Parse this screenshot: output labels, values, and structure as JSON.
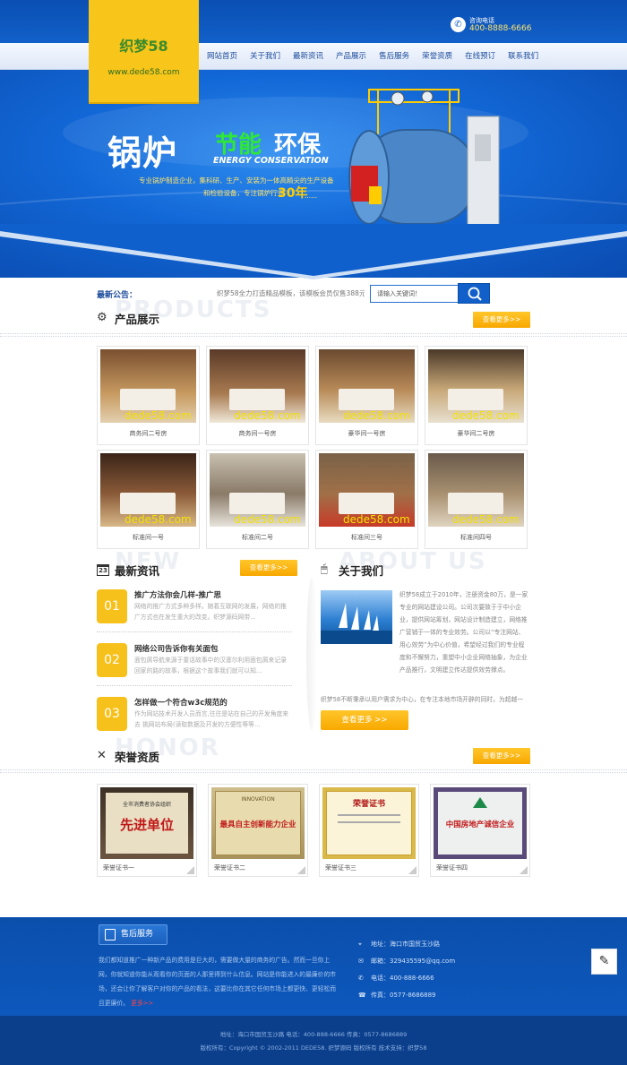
{
  "logo": {
    "name": "织梦58",
    "url": "www.dede58.com"
  },
  "hotline": {
    "label": "咨询电话",
    "number": "400-8888-6666"
  },
  "nav": [
    "网站首页",
    "关于我们",
    "最新资讯",
    "产品展示",
    "售后服务",
    "荣誉资质",
    "在线预订",
    "联系我们"
  ],
  "banner": {
    "title_part1": "锅炉",
    "title_part2": "节能",
    "title_part3": "环保",
    "english": "ENERGY CONSERVATION",
    "desc1": "专业锅炉制造企业，集科研、生产、安装为一体高精尖的生产设备",
    "desc2": "和检验设备，专注锅炉行业",
    "years": "30年",
    "desc3": "......"
  },
  "notice": {
    "label": "最新公告：",
    "text": "织梦58全力打造精品模板，该模板会员仅售388元，!",
    "search_placeholder": "请输入关键词！"
  },
  "products": {
    "bg_text": "PRODUCTS",
    "title": "产品展示",
    "more": "查看更多>>",
    "watermark": "dede58.com",
    "items": [
      "商务间二号房",
      "商务间一号房",
      "豪华间一号房",
      "豪华间二号房",
      "标准间一号",
      "标准间二号",
      "标准间三号",
      "标准间四号"
    ]
  },
  "news": {
    "bg_text": "NEW",
    "title": "最新资讯",
    "more": "查看更多>>",
    "calendar_day": "23",
    "items": [
      {
        "num": "01",
        "title": "推广方法你会几样-推广思",
        "desc": "网络的推广方式多种多样。随着互联网的发展，网络的推广方式也在发生重大的改变。织梦源码网带..."
      },
      {
        "num": "02",
        "title": "网络公司告诉你有关面包",
        "desc": "面包屑导航来源于童话故事中的汉塞尔利用面包屑来记录回家的路的故事，根据这个故事我们就可以知..."
      },
      {
        "num": "03",
        "title": "怎样做一个符合w3c规范的",
        "desc": "作为网站技术开发人员而言,往往是站在自己的开发角度来去 挑网站布局(读取数据及开发的方便性等等..."
      }
    ]
  },
  "about": {
    "bg_text": "ABOUT US",
    "title": "关于我们",
    "text": "织梦58成立于2010年，注册资金80万，是一家专业的网站建设公司。公司次要致于于中小企业，提供网站筹划，网站设计制造建立，网络推广营销于一体的专业效劳。公司以“专注网站、用心效劳”为中心价值，希望经过我们的专业程度和不懈努力，重塑中小企业网络抽象，为企业产品推行，文明建立传达提供效劳撑点。",
    "text2": "织梦58不断秉承以用户需求为中心，在专注本地市场开辟的同时，为超越一",
    "more": "查看更多 >>"
  },
  "honors": {
    "bg_text": "HONOR",
    "title": "荣誉资质",
    "more": "查看更多>>",
    "items": [
      {
        "caption": "荣誉证书一",
        "cert_top": "全市消费者协会组织",
        "cert_main": "先进单位"
      },
      {
        "caption": "荣誉证书二",
        "cert_top": "INNOVATION",
        "cert_main": "最具自主创新能力企业"
      },
      {
        "caption": "荣誉证书三",
        "cert_top": "荣誉证书",
        "cert_main": ""
      },
      {
        "caption": "荣誉证书四",
        "cert_top": "",
        "cert_main": "中国房地产诚信企业"
      }
    ]
  },
  "footer": {
    "service_title": "售后服务",
    "desc": "我们都知道推广一种新产品的费用是巨大的，需要做大量的商务的广告。然而一旦你上网，你就知道你能从观看你的页面的人那里得到什么信息。网站是你能进入的最廉价的市场，还会让你了解客户对你的产品的看法，这要比你在其它任何市场上都更快、更轻松而且更廉价。",
    "desc_more": "更多>>",
    "address": "地址：海口市国贸玉沙路",
    "email": "邮箱：329435595@qq.com",
    "phone": "电话：400-888-6666",
    "fax": "传真：0577-8686889",
    "bottom_line1": "地址：海口市国贸玉沙路    电话：400-888-6666    传真：0577-8686889",
    "bottom_line2": "版权所有：Copyright © 2002-2011 DEDE58. 织梦源码 版权所有        技术支持：织梦58"
  }
}
